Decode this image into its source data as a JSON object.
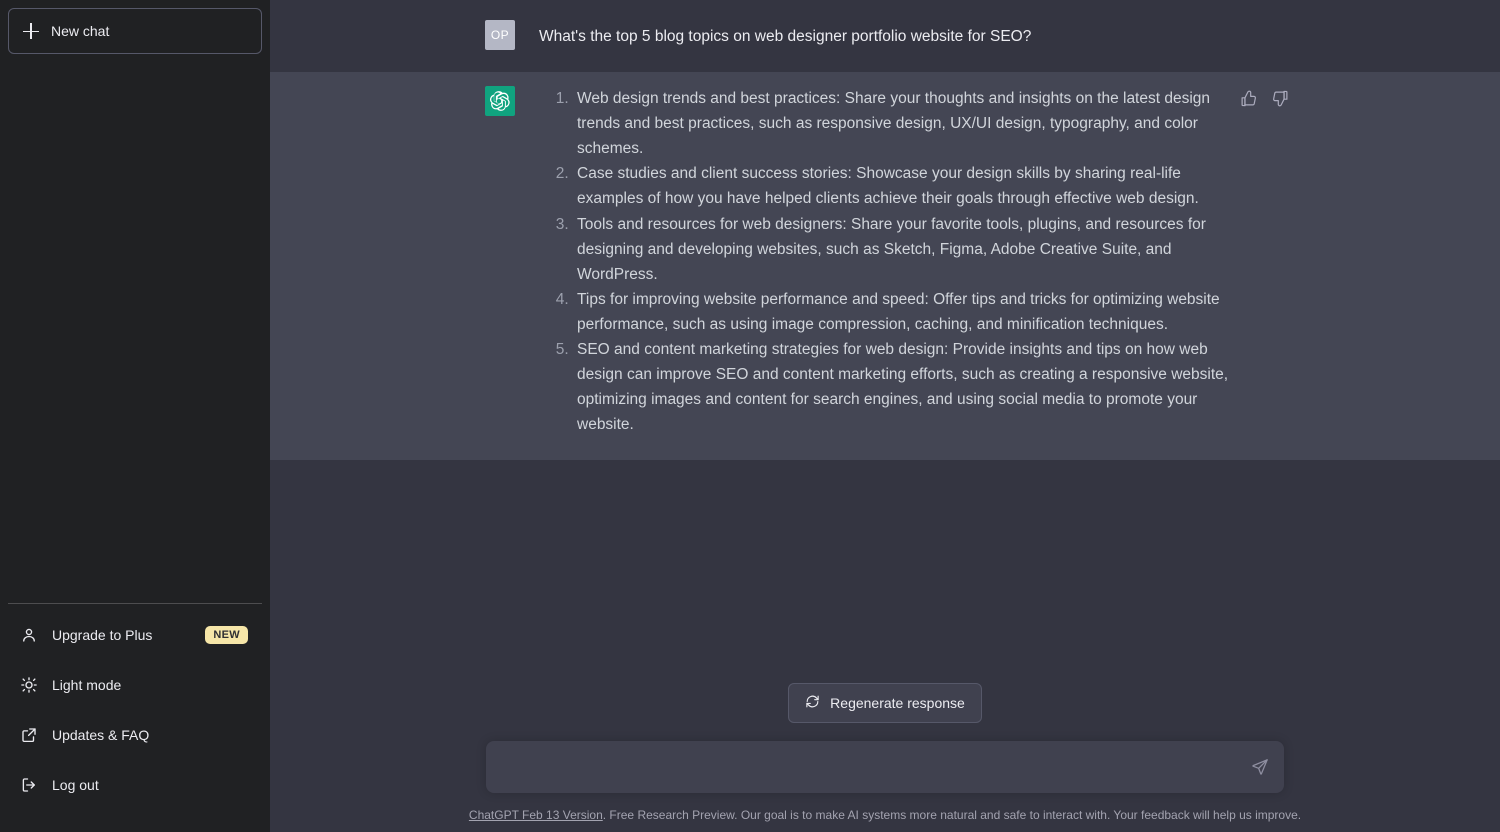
{
  "sidebar": {
    "new_chat_label": "New chat",
    "bottom_items": [
      {
        "label": "Upgrade to Plus",
        "icon": "user-icon",
        "badge": "NEW"
      },
      {
        "label": "Light mode",
        "icon": "sun-icon",
        "badge": ""
      },
      {
        "label": "Updates & FAQ",
        "icon": "external-link-icon",
        "badge": ""
      },
      {
        "label": "Log out",
        "icon": "logout-icon",
        "badge": ""
      }
    ]
  },
  "conversation": {
    "user": {
      "avatar_initials": "OP",
      "text": "What's the top 5 blog topics on web designer portfolio website for SEO?"
    },
    "assistant": {
      "avatar": "openai-logo-icon",
      "items": [
        "Web design trends and best practices: Share your thoughts and insights on the latest design trends and best practices, such as responsive design, UX/UI design, typography, and color schemes.",
        "Case studies and client success stories: Showcase your design skills by sharing real-life examples of how you have helped clients achieve their goals through effective web design.",
        "Tools and resources for web designers: Share your favorite tools, plugins, and resources for designing and developing websites, such as Sketch, Figma, Adobe Creative Suite, and WordPress.",
        "Tips for improving website performance and speed: Offer tips and tricks for optimizing website performance, such as using image compression, caching, and minification techniques.",
        "SEO and content marketing strategies for web design: Provide insights and tips on how web design can improve SEO and content marketing efforts, such as creating a responsive website, optimizing images and content for search engines, and using social media to promote your website."
      ],
      "feedback": {
        "thumbs_up": "thumbs-up-icon",
        "thumbs_down": "thumbs-down-icon"
      }
    }
  },
  "composer": {
    "regenerate_label": "Regenerate response",
    "input_value": "",
    "input_placeholder": "",
    "send_icon": "send-icon"
  },
  "footer": {
    "version_link": "ChatGPT Feb 13 Version",
    "disclaimer": ". Free Research Preview. Our goal is to make AI systems more natural and safe to interact with. Your feedback will help us improve."
  },
  "colors": {
    "sidebar_bg": "#202123",
    "user_msg_bg": "#343541",
    "assistant_msg_bg": "#444654",
    "accent_green": "#10a37f",
    "badge_yellow": "#f6e6a8",
    "input_bg": "#40414f"
  }
}
